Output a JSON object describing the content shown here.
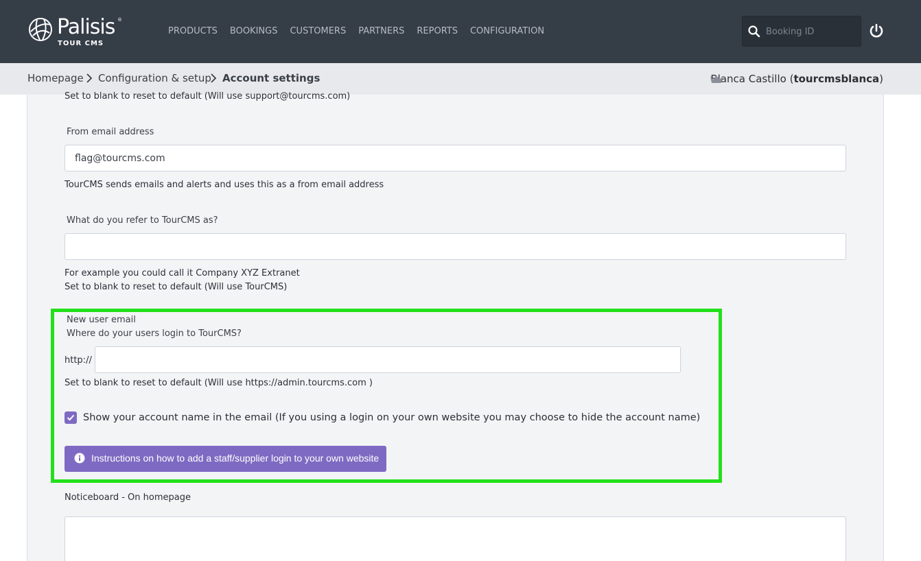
{
  "header": {
    "logo": {
      "name": "Palisis",
      "trademark": "®",
      "subtitle": "TOUR CMS"
    },
    "nav": [
      "PRODUCTS",
      "BOOKINGS",
      "CUSTOMERS",
      "PARTNERS",
      "REPORTS",
      "CONFIGURATION"
    ],
    "search": {
      "placeholder": "Booking ID",
      "value": ""
    }
  },
  "breadcrumb": {
    "items": [
      "Homepage",
      "Configuration & setup",
      "Account settings"
    ]
  },
  "user": {
    "name": "Blanca Castillo",
    "username": "tourcmsblanca",
    "open_paren": "(",
    "close_paren": ")"
  },
  "form": {
    "support_help": "Set to blank to reset to default (Will use support@tourcms.com)",
    "from_email": {
      "label": "From email address",
      "value": "flag@tourcms.com",
      "help": "TourCMS sends emails and alerts and uses this as a from email address"
    },
    "refer_name": {
      "label": "What do you refer to TourCMS as?",
      "value": "",
      "help1": "For example you could call it Company XYZ Extranet",
      "help2": "Set to blank to reset to default (Will use TourCMS)"
    },
    "new_user_email": {
      "section_label": "New user email",
      "question": "Where do your users login to TourCMS?",
      "prefix": "http://",
      "value": "",
      "help": "Set to blank to reset to default (Will use https://admin.tourcms.com )",
      "checkbox_checked": true,
      "checkbox_label": "Show your account name in the email (If you using a login on your own website you may choose to hide the account name)",
      "button_label": "Instructions on how to add a staff/supplier login to your own website"
    },
    "noticeboard": {
      "label": "Noticeboard - On homepage",
      "value": ""
    }
  },
  "colors": {
    "topbar": "#353d47",
    "accent": "#7e6ac2",
    "highlight": "#22e01a",
    "panel": "#f3f4f6"
  }
}
